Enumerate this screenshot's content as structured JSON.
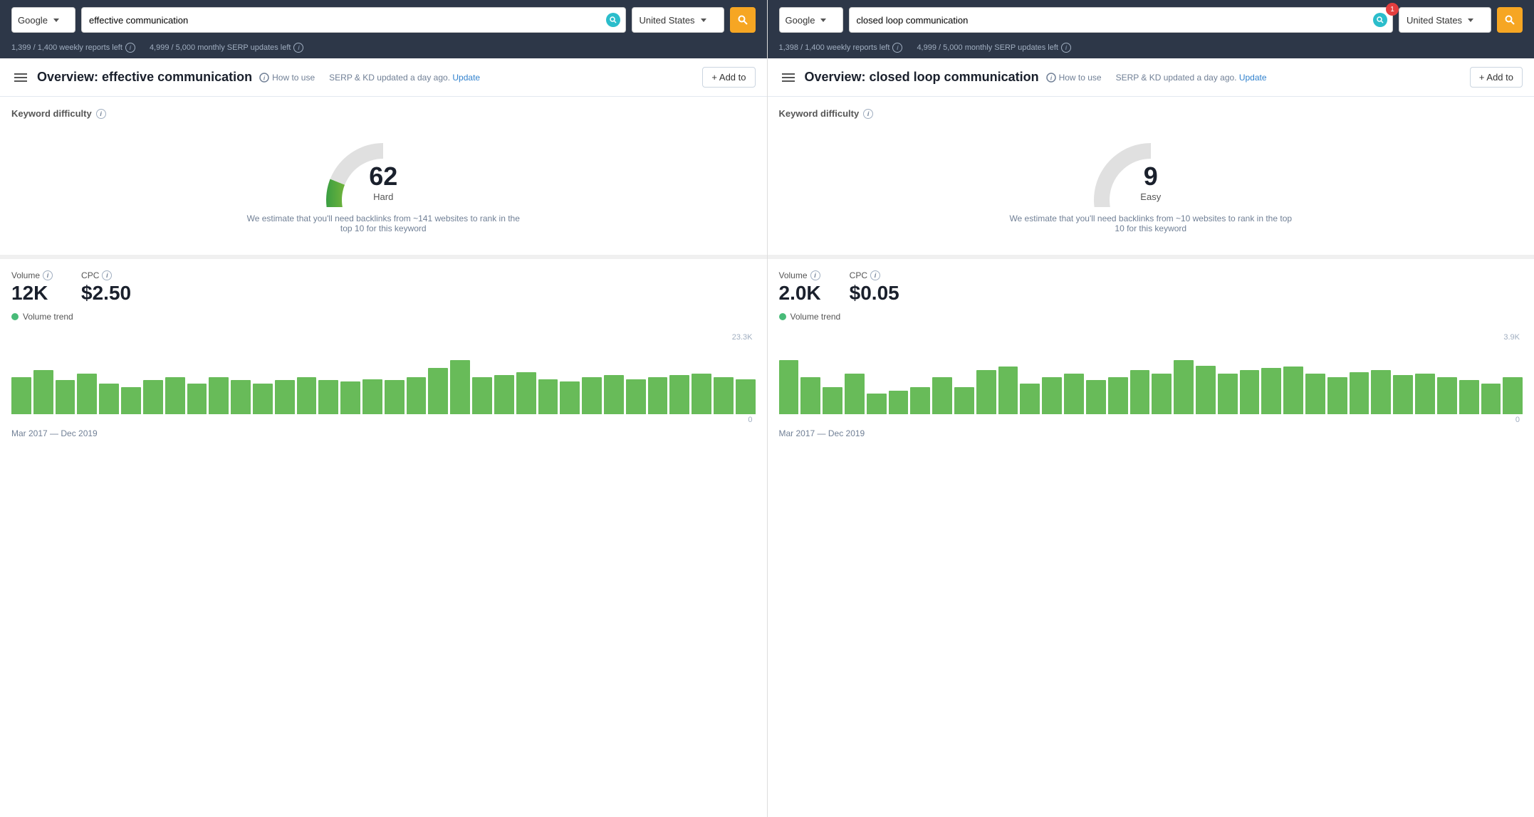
{
  "panels": [
    {
      "id": "panel-left",
      "topbar": {
        "engine": "Google",
        "query": "effective communication",
        "country": "United States",
        "reports_left": "1,399 / 1,400 weekly reports left",
        "updates_left": "4,999 / 5,000 monthly SERP updates left",
        "search_btn_label": "🔍",
        "badge": null
      },
      "overview": {
        "title": "Overview: effective communication",
        "how_to_use": "How to use",
        "update_notice": "SERP & KD updated a day ago.",
        "update_link": "Update",
        "add_to_label": "+ Add to"
      },
      "kd": {
        "label": "Keyword difficulty",
        "value": "62",
        "sublabel": "Hard",
        "estimate": "We estimate that you'll need backlinks from ~141 websites to rank in the top 10 for this keyword",
        "score": 62,
        "colors": [
          "#4caf50",
          "#8bc34a",
          "#cddc39",
          "#ffeb3b",
          "#ffc107",
          "#d3d3d3"
        ]
      },
      "volume": {
        "volume_label": "Volume",
        "volume_value": "12K",
        "cpc_label": "CPC",
        "cpc_value": "$2.50",
        "trend_label": "Volume trend",
        "y_max": "23.3K",
        "y_min": "0",
        "date_range": "Mar 2017 — Dec 2019",
        "bars": [
          55,
          65,
          50,
          60,
          45,
          40,
          50,
          55,
          45,
          55,
          50,
          45,
          50,
          55,
          50,
          48,
          52,
          50,
          55,
          68,
          80,
          55,
          58,
          62,
          52,
          48,
          55,
          58,
          52,
          55,
          58,
          60,
          55,
          52
        ]
      }
    },
    {
      "id": "panel-right",
      "topbar": {
        "engine": "Google",
        "query": "closed loop communication",
        "country": "United States",
        "reports_left": "1,398 / 1,400 weekly reports left",
        "updates_left": "4,999 / 5,000 monthly SERP updates left",
        "search_btn_label": "🔍",
        "badge": "1"
      },
      "overview": {
        "title": "Overview: closed loop communication",
        "how_to_use": "How to use",
        "update_notice": "SERP & KD updated a day ago.",
        "update_link": "Update",
        "add_to_label": "+ Add to"
      },
      "kd": {
        "label": "Keyword difficulty",
        "value": "9",
        "sublabel": "Easy",
        "estimate": "We estimate that you'll need backlinks from ~10 websites to rank in the top 10 for this keyword",
        "score": 9,
        "colors": [
          "#4caf50",
          "#d3d3d3",
          "#d3d3d3",
          "#d3d3d3",
          "#d3d3d3",
          "#d3d3d3"
        ]
      },
      "volume": {
        "volume_label": "Volume",
        "volume_value": "2.0K",
        "cpc_label": "CPC",
        "cpc_value": "$0.05",
        "trend_label": "Volume trend",
        "y_max": "3.9K",
        "y_min": "0",
        "date_range": "Mar 2017 — Dec 2019",
        "bars": [
          80,
          55,
          40,
          60,
          30,
          35,
          40,
          55,
          40,
          65,
          70,
          45,
          55,
          60,
          50,
          55,
          65,
          60,
          80,
          72,
          60,
          65,
          68,
          70,
          60,
          55,
          62,
          65,
          58,
          60,
          55,
          50,
          45,
          55
        ]
      }
    }
  ],
  "icons": {
    "search": "⚙",
    "help": "?",
    "hamburger": "☰"
  }
}
